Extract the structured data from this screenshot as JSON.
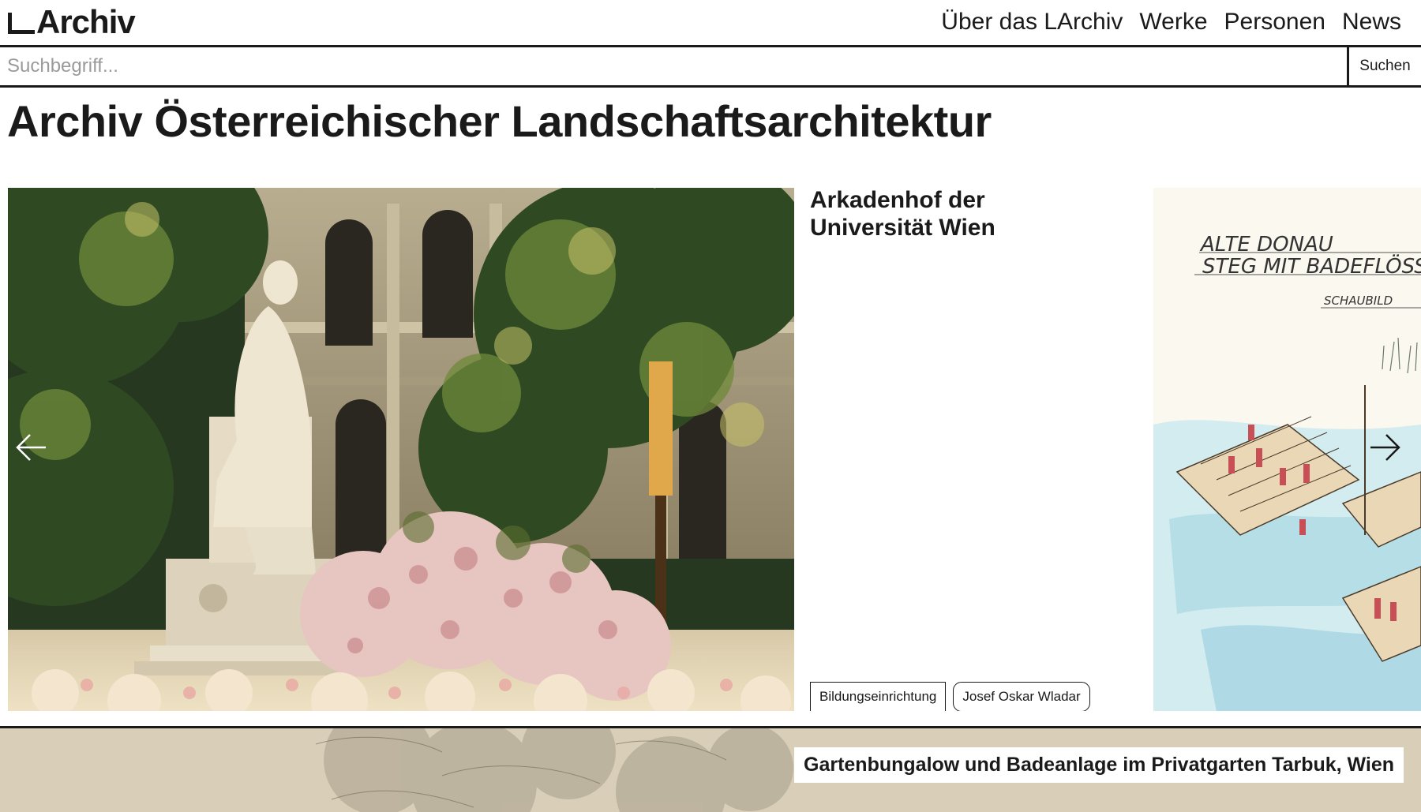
{
  "header": {
    "logo_text": "Archiv",
    "nav": [
      {
        "label": "Über das LArchiv"
      },
      {
        "label": "Werke"
      },
      {
        "label": "Personen"
      },
      {
        "label": "News"
      }
    ]
  },
  "search": {
    "placeholder": "Suchbegriff...",
    "value": "",
    "button_label": "Suchen"
  },
  "main": {
    "title": "Archiv Österreichischer Landschaftsarchitektur"
  },
  "carousel": {
    "current": {
      "title": "Arkadenhof der Universität Wien",
      "tags": [
        {
          "label": "Bildungseinrichtung"
        },
        {
          "label": "Josef Oskar Wladar"
        }
      ]
    },
    "next": {
      "sketch_lines": [
        "ALTE DONAU",
        "STEG MIT BADEFLÖSS",
        "SCHAUBILD"
      ]
    },
    "prev_icon": "arrow-left-icon",
    "next_icon": "arrow-right-icon"
  },
  "featured": {
    "caption": "Gartenbungalow und Badeanlage im Privatgarten Tarbuk, Wien"
  }
}
